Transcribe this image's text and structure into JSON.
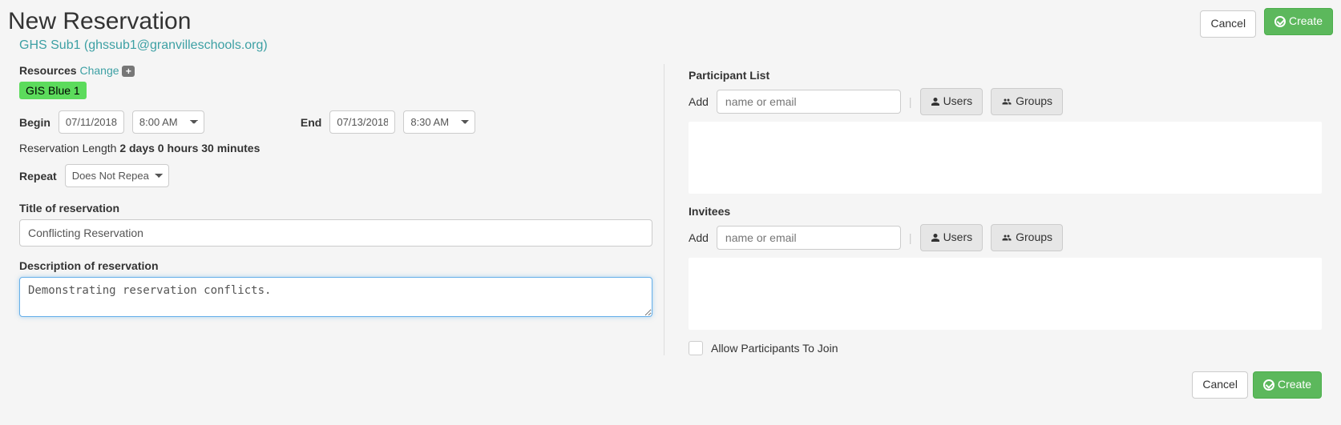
{
  "header": {
    "title": "New Reservation",
    "owner": "GHS Sub1 (ghssub1@granvilleschools.org)",
    "cancel_label": "Cancel",
    "create_label": "Create"
  },
  "left": {
    "resources_label": "Resources",
    "change_label": "Change",
    "resource_tag": "GIS Blue 1",
    "begin_label": "Begin",
    "begin_date": "07/11/2018",
    "begin_time": "8:00 AM",
    "end_label": "End",
    "end_date": "07/13/2018",
    "end_time": "8:30 AM",
    "length_label": "Reservation Length",
    "length_value": "2 days 0 hours 30 minutes",
    "repeat_label": "Repeat",
    "repeat_value": "Does Not Repeat",
    "title_label": "Title of reservation",
    "title_value": "Conflicting Reservation",
    "desc_label": "Description of reservation",
    "desc_value": "Demonstrating reservation conflicts."
  },
  "right": {
    "participant_heading": "Participant List",
    "add_label": "Add",
    "name_placeholder": "name or email",
    "users_label": "Users",
    "groups_label": "Groups",
    "invitees_heading": "Invitees",
    "allow_join_label": "Allow Participants To Join"
  }
}
